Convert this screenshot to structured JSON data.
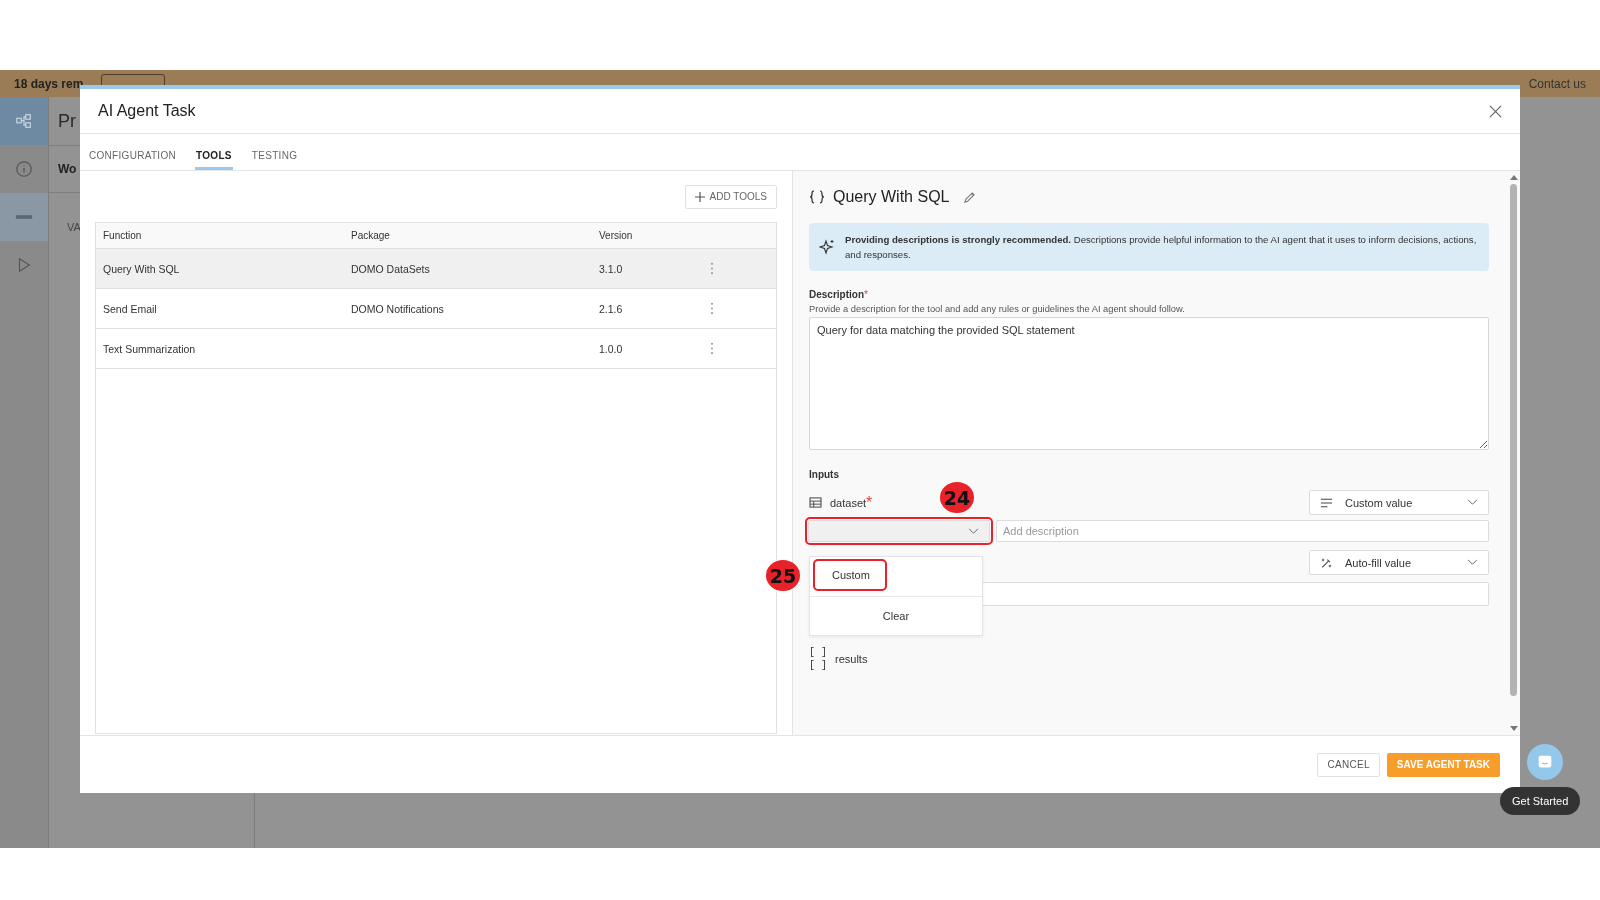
{
  "trial_banner": {
    "text": "18 days rem",
    "contact": "Contact us"
  },
  "background": {
    "title": "Pr",
    "section": "Wo",
    "label": "VA"
  },
  "modal": {
    "title": "AI Agent Task",
    "tabs": [
      {
        "label": "CONFIGURATION",
        "selected": false
      },
      {
        "label": "TOOLS",
        "selected": true
      },
      {
        "label": "TESTING",
        "selected": false
      }
    ],
    "add_tools": "ADD TOOLS",
    "table": {
      "columns": [
        "Function",
        "Package",
        "Version"
      ],
      "rows": [
        {
          "cells": [
            "Query With SQL",
            "DOMO DataSets",
            "3.1.0"
          ],
          "selected": true
        },
        {
          "cells": [
            "Send Email",
            "DOMO Notifications",
            "2.1.6"
          ],
          "selected": false
        },
        {
          "cells": [
            "Text Summarization",
            "",
            "1.0.0"
          ],
          "selected": false
        }
      ]
    },
    "detail": {
      "title": "Query With SQL",
      "notice": "**Providing descriptions is strongly recommended.** Descriptions provide helpful information to the AI agent that it uses to inform decisions, actions, and responses.",
      "description_label": "Description",
      "required_mark": "*",
      "description_hint": "Provide a description for the tool and add any rules or guidelines the AI agent should follow.",
      "description_value": "Query for data matching the provided SQL statement",
      "inputs_label": "Inputs",
      "input": {
        "name": "dataset",
        "required_mark": "*",
        "mode": "Custom value",
        "description_placeholder": "Add description",
        "menu": [
          "Custom",
          "Clear"
        ],
        "second_mode": "Auto-fill value"
      },
      "output": {
        "icon": "[ ]\n[ ]",
        "name": "results"
      }
    },
    "buttons": {
      "cancel": "CANCEL",
      "save": "SAVE AGENT TASK"
    }
  },
  "chat": {
    "tooltip": "Get Started"
  },
  "annotations": [
    {
      "label": "24",
      "kind": "field"
    },
    {
      "label": "25",
      "kind": "item"
    }
  ]
}
